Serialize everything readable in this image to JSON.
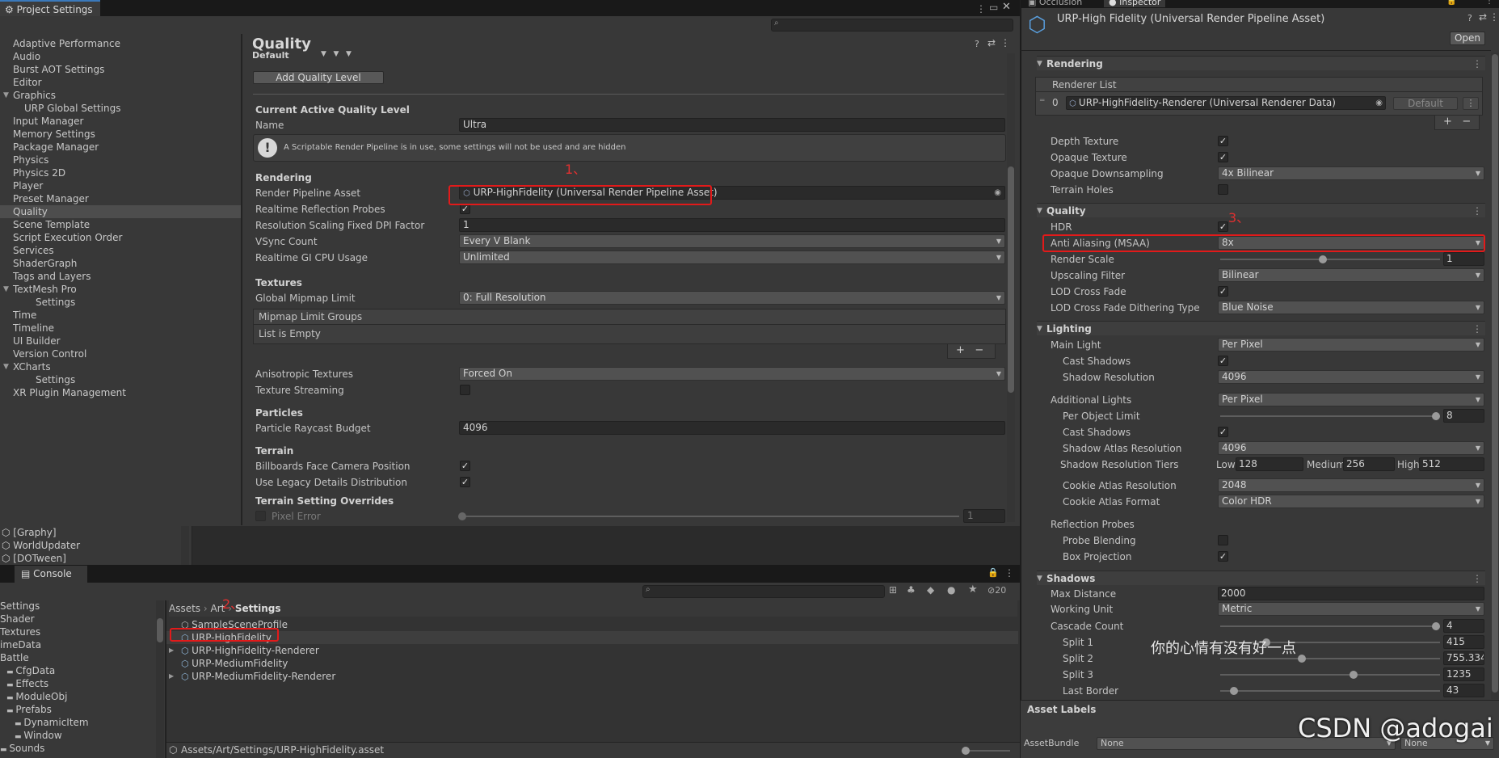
{
  "project_settings": {
    "tab_title": "Project Settings",
    "nav_items": [
      "Adaptive Performance",
      "Audio",
      "Burst AOT Settings",
      "Editor",
      "Graphics",
      "URP Global Settings",
      "Input Manager",
      "Memory Settings",
      "Package Manager",
      "Physics",
      "Physics 2D",
      "Player",
      "Preset Manager",
      "Quality",
      "Scene Template",
      "Script Execution Order",
      "Services",
      "ShaderGraph",
      "Tags and Layers",
      "TextMesh Pro",
      "Settings",
      "Time",
      "Timeline",
      "UI Builder",
      "Version Control",
      "XCharts",
      "Settings",
      "XR Plugin Management"
    ],
    "selected_item": "Quality",
    "quality": {
      "title": "Quality",
      "default_label": "Default",
      "add_button": "Add Quality Level",
      "current_level_header": "Current Active Quality Level",
      "name_label": "Name",
      "name_value": "Ultra",
      "info_text": "A Scriptable Render Pipeline is in use, some settings will not be used and are hidden",
      "rendering_header": "Rendering",
      "rpa_label": "Render Pipeline Asset",
      "rpa_value": "URP-HighFidelity (Universal Render Pipeline Asset)",
      "reflection_probes_label": "Realtime Reflection Probes",
      "dpi_label": "Resolution Scaling Fixed DPI Factor",
      "dpi_value": "1",
      "vsync_label": "VSync Count",
      "vsync_value": "Every V Blank",
      "gi_label": "Realtime GI CPU Usage",
      "gi_value": "Unlimited",
      "textures_header": "Textures",
      "mipmap_label": "Global Mipmap Limit",
      "mipmap_value": "0: Full Resolution",
      "mipmap_groups_label": "Mipmap Limit Groups",
      "list_empty": "List is Empty",
      "aniso_label": "Anisotropic Textures",
      "aniso_value": "Forced On",
      "streaming_label": "Texture Streaming",
      "particles_header": "Particles",
      "raycast_label": "Particle Raycast Budget",
      "raycast_value": "4096",
      "terrain_header": "Terrain",
      "billboards_label": "Billboards Face Camera Position",
      "legacy_label": "Use Legacy Details Distribution",
      "terrain_overrides_header": "Terrain Setting Overrides",
      "pixel_error_label": "Pixel Error",
      "pixel_error_value": "1"
    },
    "annotation_1": "1、"
  },
  "hierarchy": {
    "items": [
      "[Graphy]",
      "WorldUpdater",
      "[DOTween]"
    ]
  },
  "console": {
    "tab_title": "Console",
    "hidden_count": "20"
  },
  "project": {
    "tree": [
      "Settings",
      "Shader",
      "Textures",
      "imeData",
      "Battle",
      "CfgData",
      "Effects",
      "ModuleObj",
      "Prefabs",
      "DynamicItem",
      "Window",
      "Sounds"
    ],
    "breadcrumb": [
      "Assets",
      "Art",
      "Settings"
    ],
    "files": [
      "SampleSceneProfile",
      "URP-HighFidelity",
      "URP-HighFidelity-Renderer",
      "URP-MediumFidelity",
      "URP-MediumFidelity-Renderer"
    ],
    "status_path": "Assets/Art/Settings/URP-HighFidelity.asset",
    "annotation_2": "2、"
  },
  "inspector": {
    "tabs": [
      "Occlusion",
      "Inspector"
    ],
    "asset_title": "URP-High Fidelity (Universal Render Pipeline Asset)",
    "open_button": "Open",
    "rendering_header": "Rendering",
    "renderer_list_label": "Renderer List",
    "renderer_index": "0",
    "renderer_value": "URP-HighFidelity-Renderer (Universal Renderer Data)",
    "default_button": "Default",
    "depth_texture": "Depth Texture",
    "opaque_texture": "Opaque Texture",
    "opaque_downsampling": "Opaque Downsampling",
    "opaque_downsampling_value": "4x Bilinear",
    "terrain_holes": "Terrain Holes",
    "quality_header": "Quality",
    "hdr": "HDR",
    "msaa": "Anti Aliasing (MSAA)",
    "msaa_value": "8x",
    "render_scale": "Render Scale",
    "render_scale_value": "1",
    "upscaling_filter": "Upscaling Filter",
    "upscaling_filter_value": "Bilinear",
    "lod_cross_fade": "LOD Cross Fade",
    "lod_dither": "LOD Cross Fade Dithering Type",
    "lod_dither_value": "Blue Noise",
    "lighting_header": "Lighting",
    "main_light": "Main Light",
    "main_light_value": "Per Pixel",
    "cast_shadows": "Cast Shadows",
    "shadow_resolution": "Shadow Resolution",
    "shadow_resolution_value": "4096",
    "additional_lights": "Additional Lights",
    "additional_lights_value": "Per Pixel",
    "per_object_limit": "Per Object Limit",
    "per_object_limit_value": "8",
    "cast_shadows_2": "Cast Shadows",
    "shadow_atlas": "Shadow Atlas Resolution",
    "shadow_atlas_value": "4096",
    "shadow_tiers": "Shadow Resolution Tiers",
    "tier_low_label": "Low",
    "tier_low": "128",
    "tier_med_label": "Medium",
    "tier_med": "256",
    "tier_high_label": "High",
    "tier_high": "512",
    "cookie_res": "Cookie Atlas Resolution",
    "cookie_res_value": "2048",
    "cookie_format": "Cookie Atlas Format",
    "cookie_format_value": "Color HDR",
    "reflection_probes": "Reflection Probes",
    "probe_blending": "Probe Blending",
    "box_projection": "Box Projection",
    "shadows_header": "Shadows",
    "max_distance": "Max Distance",
    "max_distance_value": "2000",
    "working_unit": "Working Unit",
    "working_unit_value": "Metric",
    "cascade_count": "Cascade Count",
    "cascade_count_value": "4",
    "split1": "Split 1",
    "split1_value": "415",
    "split2": "Split 2",
    "split2_value": "755.334",
    "split3": "Split 3",
    "split3_value": "1235",
    "last_border": "Last Border",
    "last_border_value": "43",
    "asset_labels": "Asset Labels",
    "asset_bundle": "AssetBundle",
    "asset_bundle_value": "None",
    "asset_bundle_variant": "None",
    "annotation_3": "3、",
    "overlay_text": "你的心情有没有好一点",
    "watermark": "CSDN @adogai"
  },
  "colors": {
    "annotation_red": "#e21a1a",
    "selection": "#4d4d4d",
    "accent": "#3a79bb"
  }
}
